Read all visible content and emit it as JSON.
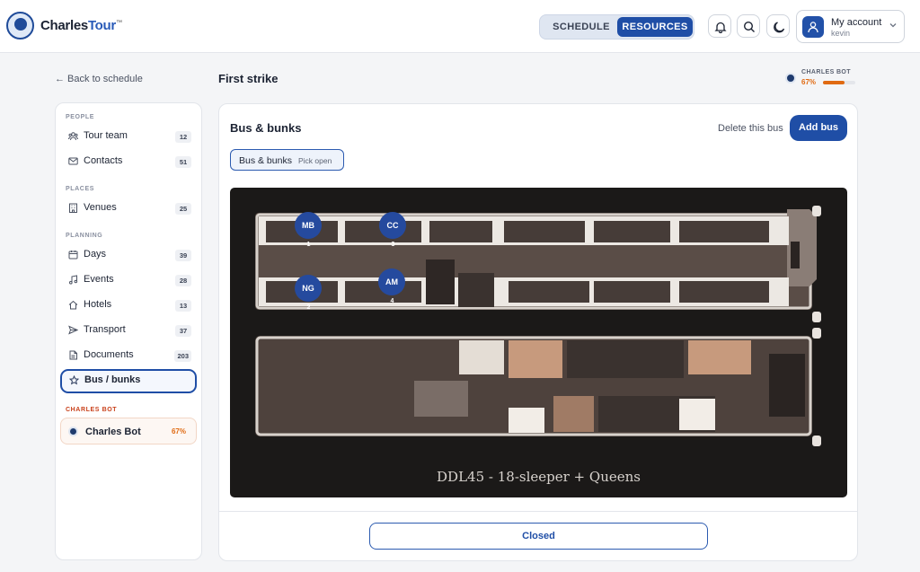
{
  "header": {
    "brand_main": "Charles",
    "brand_accent": "Tour",
    "brand_tm": "™",
    "tabs": [
      {
        "label": "SCHEDULE"
      },
      {
        "label": "RESOURCES"
      }
    ],
    "active_tab": "RESOURCES",
    "account": {
      "label": "My account",
      "user": "kevin"
    }
  },
  "nav": {
    "back": "← Back to schedule"
  },
  "page": {
    "title": "First strike"
  },
  "bot_status": {
    "label": "CHARLES BOT",
    "percent": "67%",
    "progress": 0.67
  },
  "sidebar": {
    "sections": [
      {
        "title": "PEOPLE",
        "items": [
          {
            "label": "Tour team",
            "count": "12"
          },
          {
            "label": "Contacts",
            "count": "51"
          }
        ]
      },
      {
        "title": "PLACES",
        "items": [
          {
            "label": "Venues",
            "count": "25"
          }
        ]
      },
      {
        "title": "PLANNING",
        "items": [
          {
            "label": "Days",
            "count": "39"
          },
          {
            "label": "Events",
            "count": "28"
          },
          {
            "label": "Hotels",
            "count": "13"
          },
          {
            "label": "Transport",
            "count": "37"
          },
          {
            "label": "Documents",
            "count": "203"
          },
          {
            "label": "Bus / bunks",
            "count": ""
          }
        ]
      },
      {
        "title": "CHARLES BOT",
        "items": [
          {
            "label": "Charles Bot",
            "count": "67%"
          }
        ]
      }
    ],
    "active_item": "Bus / bunks"
  },
  "main": {
    "title": "Bus & bunks",
    "delete_label": "Delete this bus",
    "add_label": "Add bus",
    "chip": {
      "label": "Bus & bunks",
      "status": "Pick open"
    },
    "bus_caption": "DDL45 - 18-sleeper + Queens",
    "bunks": [
      {
        "initials": "MB",
        "number": "1"
      },
      {
        "initials": "CC",
        "number": "3"
      },
      {
        "initials": "NG",
        "number": "2"
      },
      {
        "initials": "AM",
        "number": "4"
      }
    ],
    "closed_label": "Closed"
  },
  "colors": {
    "accent": "#1f4ea6",
    "warning": "#e06a12",
    "plan_bg": "#1b1918"
  }
}
